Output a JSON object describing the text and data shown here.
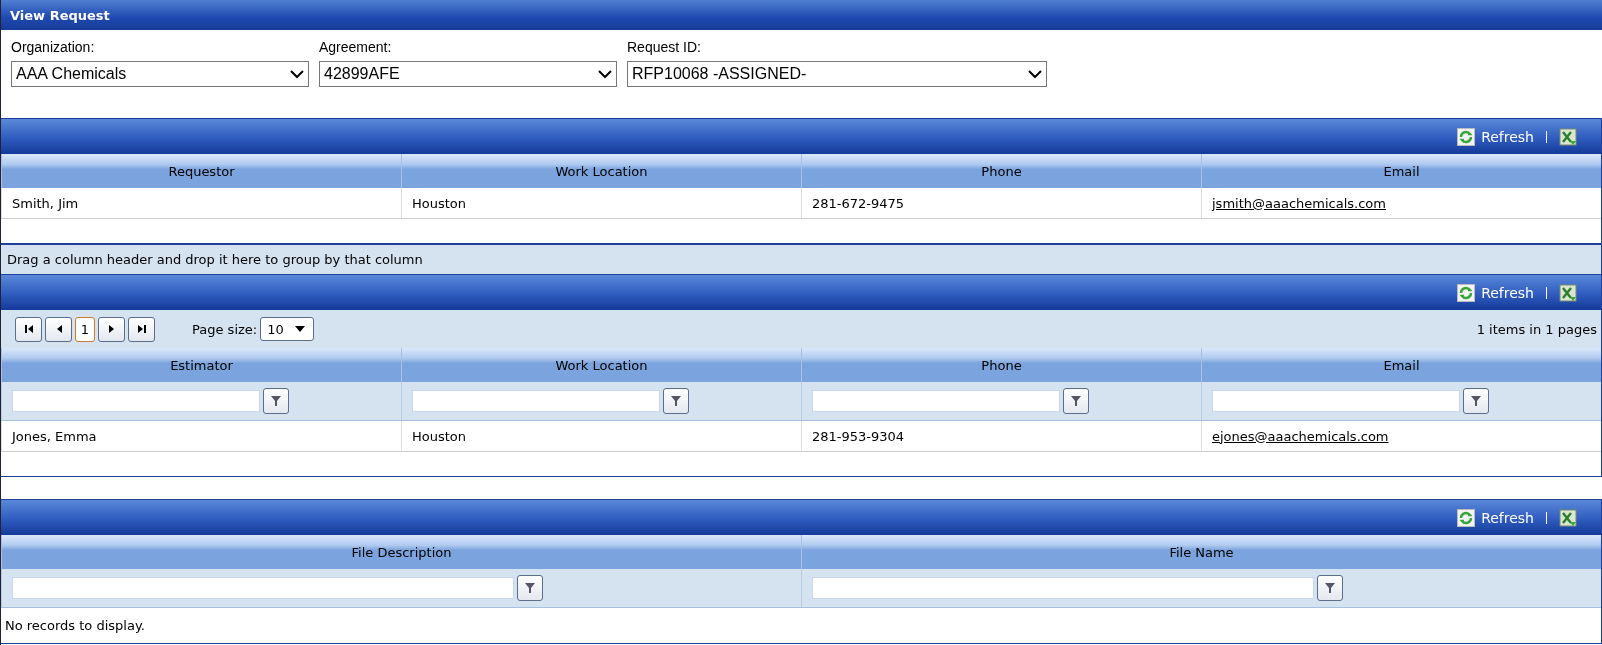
{
  "window": {
    "title": "View Request"
  },
  "filters": [
    {
      "label": "Organization:",
      "value": "AAA Chemicals"
    },
    {
      "label": "Agreement:",
      "value": "42899AFE"
    },
    {
      "label": "Request ID:",
      "value": "RFP10068 -ASSIGNED-"
    }
  ],
  "requestor_grid": {
    "refresh": "Refresh",
    "columns": [
      {
        "label": "Requestor",
        "kind": "text"
      },
      {
        "label": "Work Location",
        "kind": "text"
      },
      {
        "label": "Phone",
        "kind": "text"
      },
      {
        "label": "Email",
        "kind": "link"
      }
    ],
    "rows": [
      [
        "Smith, Jim",
        "Houston",
        "281-672-9475",
        "jsmith@aaachemicals.com"
      ]
    ]
  },
  "estimator_grid": {
    "group_panel": "Drag a column header and drop it here to group by that column",
    "refresh": "Refresh",
    "pager": {
      "pages": [
        {
          "label": "1",
          "selected": true
        }
      ],
      "page_size_label": "Page size:",
      "page_size": "10",
      "summary": "1 items in 1 pages"
    },
    "columns": [
      {
        "label": "Estimator",
        "kind": "text"
      },
      {
        "label": "Work Location",
        "kind": "text"
      },
      {
        "label": "Phone",
        "kind": "text"
      },
      {
        "label": "Email",
        "kind": "link"
      }
    ],
    "rows": [
      [
        "Jones, Emma",
        "Houston",
        "281-953-9304",
        "ejones@aaachemicals.com"
      ]
    ]
  },
  "files_grid": {
    "refresh": "Refresh",
    "columns": [
      {
        "label": "File Description"
      },
      {
        "label": "File Name"
      }
    ],
    "empty_message": "No records to display."
  }
}
